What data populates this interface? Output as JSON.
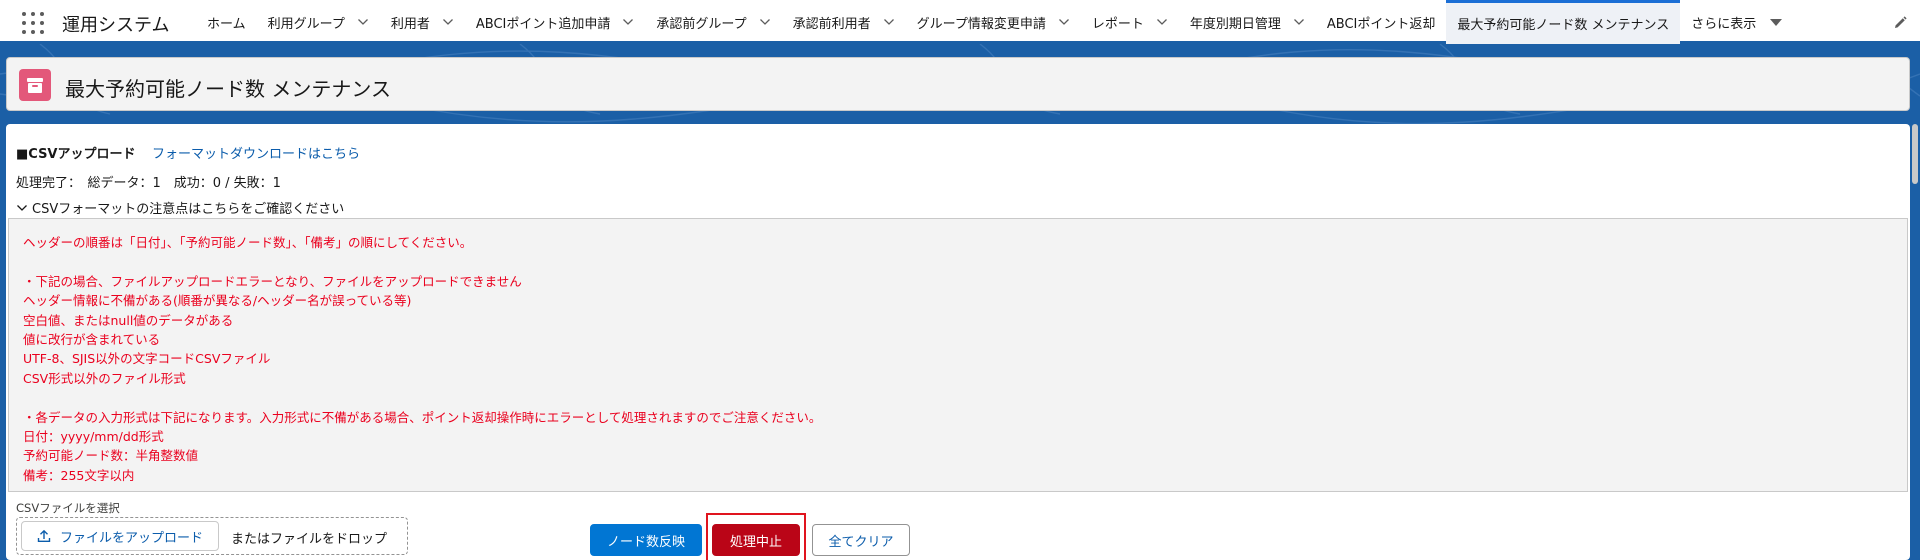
{
  "app": {
    "name": "運用システム"
  },
  "nav": {
    "items": [
      {
        "label": "ホーム",
        "dropdown": false
      },
      {
        "label": "利用グループ",
        "dropdown": true
      },
      {
        "label": "利用者",
        "dropdown": true
      },
      {
        "label": "ABCIポイント追加申請",
        "dropdown": true
      },
      {
        "label": "承認前グループ",
        "dropdown": true
      },
      {
        "label": "承認前利用者",
        "dropdown": true
      },
      {
        "label": "グループ情報変更申請",
        "dropdown": true
      },
      {
        "label": "レポート",
        "dropdown": true
      },
      {
        "label": "年度別期日管理",
        "dropdown": true
      },
      {
        "label": "ABCIポイント返却",
        "dropdown": false
      },
      {
        "label": "最大予約可能ノード数 メンテナンス",
        "dropdown": false,
        "active": true
      }
    ],
    "more_label": "さらに表示"
  },
  "page": {
    "title": "最大予約可能ノード数 メンテナンス"
  },
  "csv": {
    "section_title": "■CSVアップロード",
    "format_link": "フォーマットダウンロードはこちら",
    "status": "処理完了：　総データ：1　成功：0 / 失敗：1",
    "notes_toggle": "CSVフォーマットの注意点はこちらをご確認ください",
    "notes": [
      "ヘッダーの順番は「日付」、「予約可能ノード数」、「備考」の順にしてください。",
      "",
      "・下記の場合、ファイルアップロードエラーとなり、ファイルをアップロードできません",
      "ヘッダー情報に不備がある(順番が異なる/ヘッダー名が誤っている等)",
      "空白値、またはnull値のデータがある",
      "値に改行が含まれている",
      "UTF-8、SJIS以外の文字コードCSVファイル",
      "CSV形式以外のファイル形式",
      "",
      "・各データの入力形式は下記になります。入力形式に不備がある場合、ポイント返却操作時にエラーとして処理されますのでご注意ください。",
      "日付：yyyy/mm/dd形式",
      "予約可能ノード数：半角整数値",
      "備考：255文字以内"
    ],
    "file_label": "CSVファイルを選択",
    "upload_button": "ファイルをアップロード",
    "drop_text": "またはファイルをドロップ"
  },
  "actions": {
    "apply": "ノード数反映",
    "abort": "処理中止",
    "clear": "全てクリア"
  },
  "colors": {
    "brand": "#0176d3",
    "header_band": "#1b5fa6",
    "error_text": "#ea001e",
    "abort_button": "#ba0517",
    "highlight_box": "#e0141e",
    "page_icon": "#e3587a"
  }
}
